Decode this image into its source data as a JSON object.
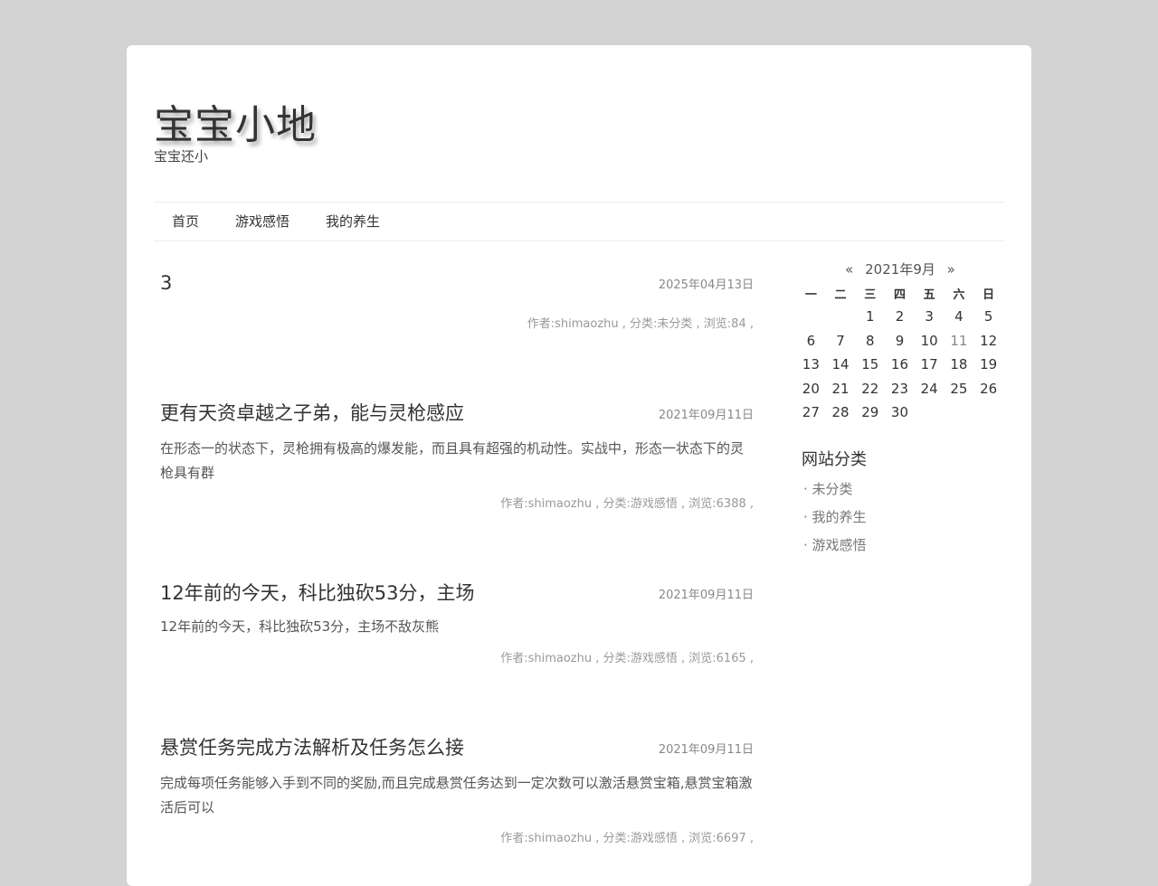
{
  "site": {
    "title": "宝宝小地",
    "description": "宝宝还小"
  },
  "nav": [
    {
      "label": "首页"
    },
    {
      "label": "游戏感悟"
    },
    {
      "label": "我的养生"
    }
  ],
  "posts": [
    {
      "title": "3",
      "date": "2025年04月13日",
      "excerpt": "",
      "meta": "作者:shimaozhu , 分类:未分类 , 浏览:84 ,"
    },
    {
      "title": "更有天资卓越之子弟，能与灵枪感应",
      "date": "2021年09月11日",
      "excerpt": "在形态一的状态下，灵枪拥有极高的爆发能，而且具有超强的机动性。实战中，形态一状态下的灵枪具有群",
      "meta": "作者:shimaozhu , 分类:游戏感悟 , 浏览:6388 ,"
    },
    {
      "title": "12年前的今天，科比独砍53分，主场",
      "date": "2021年09月11日",
      "excerpt": "12年前的今天，科比独砍53分，主场不敌灰熊",
      "meta": "作者:shimaozhu , 分类:游戏感悟 , 浏览:6165 ,"
    },
    {
      "title": "悬赏任务完成方法解析及任务怎么接",
      "date": "2021年09月11日",
      "excerpt": "完成每项任务能够入手到不同的奖励,而且完成悬赏任务达到一定次数可以激活悬赏宝箱,悬赏宝箱激活后可以",
      "meta": "作者:shimaozhu , 分类:游戏感悟 , 浏览:6697 ,"
    }
  ],
  "calendar": {
    "prev": "«",
    "month": "2021年9月",
    "next": "»",
    "weekdays": [
      "一",
      "二",
      "三",
      "四",
      "五",
      "六",
      "日"
    ],
    "weeks": [
      [
        "",
        "",
        "1",
        "2",
        "3",
        "4",
        "5"
      ],
      [
        "6",
        "7",
        "8",
        "9",
        "10",
        "11",
        "12"
      ],
      [
        "13",
        "14",
        "15",
        "16",
        "17",
        "18",
        "19"
      ],
      [
        "20",
        "21",
        "22",
        "23",
        "24",
        "25",
        "26"
      ],
      [
        "27",
        "28",
        "29",
        "30",
        "",
        "",
        ""
      ]
    ],
    "highlight": "11"
  },
  "categories": {
    "title": "网站分类",
    "items": [
      {
        "label": "· 未分类"
      },
      {
        "label": "· 我的养生"
      },
      {
        "label": "· 游戏感悟"
      }
    ]
  }
}
